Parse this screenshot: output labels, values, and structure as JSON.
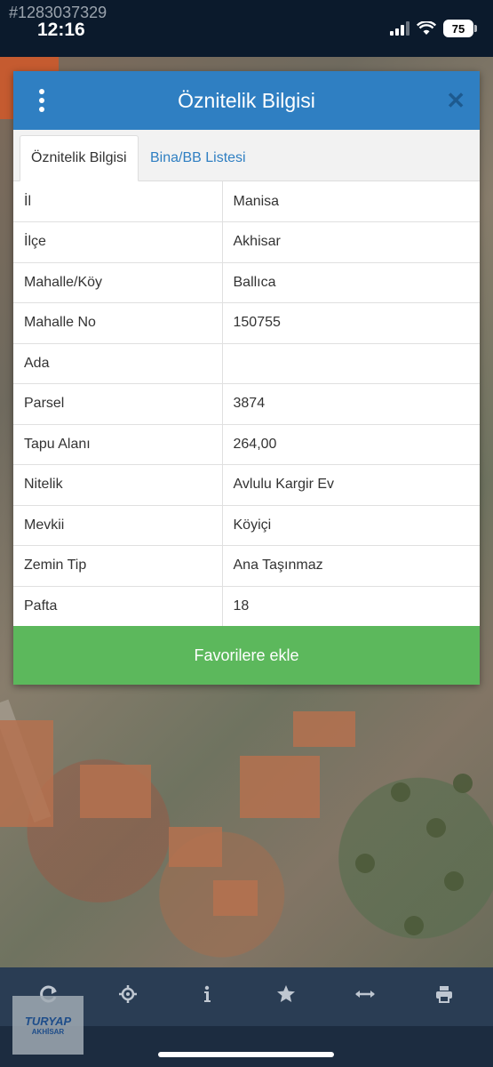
{
  "status_bar": {
    "watermark_id": "#1283037329",
    "time": "12:16",
    "battery": "75"
  },
  "dialog": {
    "title": "Öznitelik Bilgisi",
    "tabs": [
      {
        "label": "Öznitelik Bilgisi",
        "active": true
      },
      {
        "label": "Bina/BB Listesi",
        "active": false
      }
    ],
    "rows": [
      {
        "key": "İl",
        "value": "Manisa"
      },
      {
        "key": "İlçe",
        "value": "Akhisar"
      },
      {
        "key": "Mahalle/Köy",
        "value": "Ballıca"
      },
      {
        "key": "Mahalle No",
        "value": "150755"
      },
      {
        "key": "Ada",
        "value": ""
      },
      {
        "key": "Parsel",
        "value": "3874"
      },
      {
        "key": "Tapu Alanı",
        "value": "264,00"
      },
      {
        "key": "Nitelik",
        "value": "Avlulu Kargir Ev"
      },
      {
        "key": "Mevkii",
        "value": "Köyiçi"
      },
      {
        "key": "Zemin Tip",
        "value": "Ana Taşınmaz"
      },
      {
        "key": "Pafta",
        "value": "18"
      }
    ],
    "favorite_button": "Favorilere ekle",
    "close_icon": "close-icon",
    "menu_icon": "kebab-menu-icon"
  },
  "toolbar": {
    "icons": [
      "refresh-icon",
      "locate-icon",
      "info-icon",
      "star-icon",
      "measure-icon",
      "print-icon"
    ]
  },
  "logo": {
    "text": "TURYAP",
    "sub": "AKHİSAR"
  },
  "colors": {
    "header": "#2f7fc2",
    "favorite": "#5cb85c",
    "toolbar": "#2a3d54"
  }
}
